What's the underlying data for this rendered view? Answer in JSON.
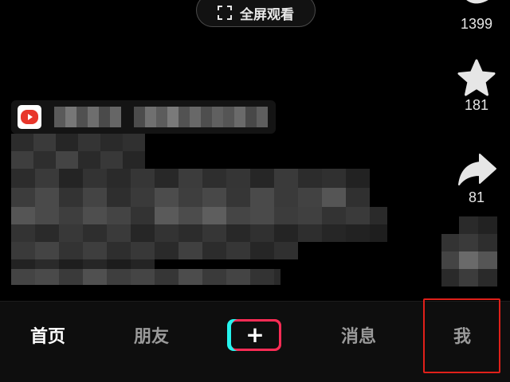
{
  "fullscreen_button": {
    "label": "全屏观看",
    "icon": "fullscreen-corners-icon"
  },
  "side_actions": [
    {
      "id": "like",
      "icon": "heart-icon",
      "count": "1399"
    },
    {
      "id": "favorite",
      "icon": "star-icon",
      "count": "181"
    },
    {
      "id": "share",
      "icon": "share-arrow-icon",
      "count": "81"
    }
  ],
  "author": {
    "logo_icon": "play-logo-icon",
    "name_redacted": true
  },
  "caption": {
    "redacted": true
  },
  "tabbar": {
    "tabs": [
      {
        "id": "home",
        "label": "首页",
        "active": true
      },
      {
        "id": "friends",
        "label": "朋友",
        "active": false
      },
      {
        "id": "create",
        "label": "+",
        "icon": "plus-icon"
      },
      {
        "id": "messages",
        "label": "消息",
        "active": false
      },
      {
        "id": "me",
        "label": "我",
        "active": false,
        "highlighted": true
      }
    ]
  },
  "colors": {
    "background": "#000000",
    "tabbar": "#0e0e0e",
    "accent_cyan": "#25f4ee",
    "accent_red": "#fe2c55",
    "highlight": "#e0201a"
  }
}
